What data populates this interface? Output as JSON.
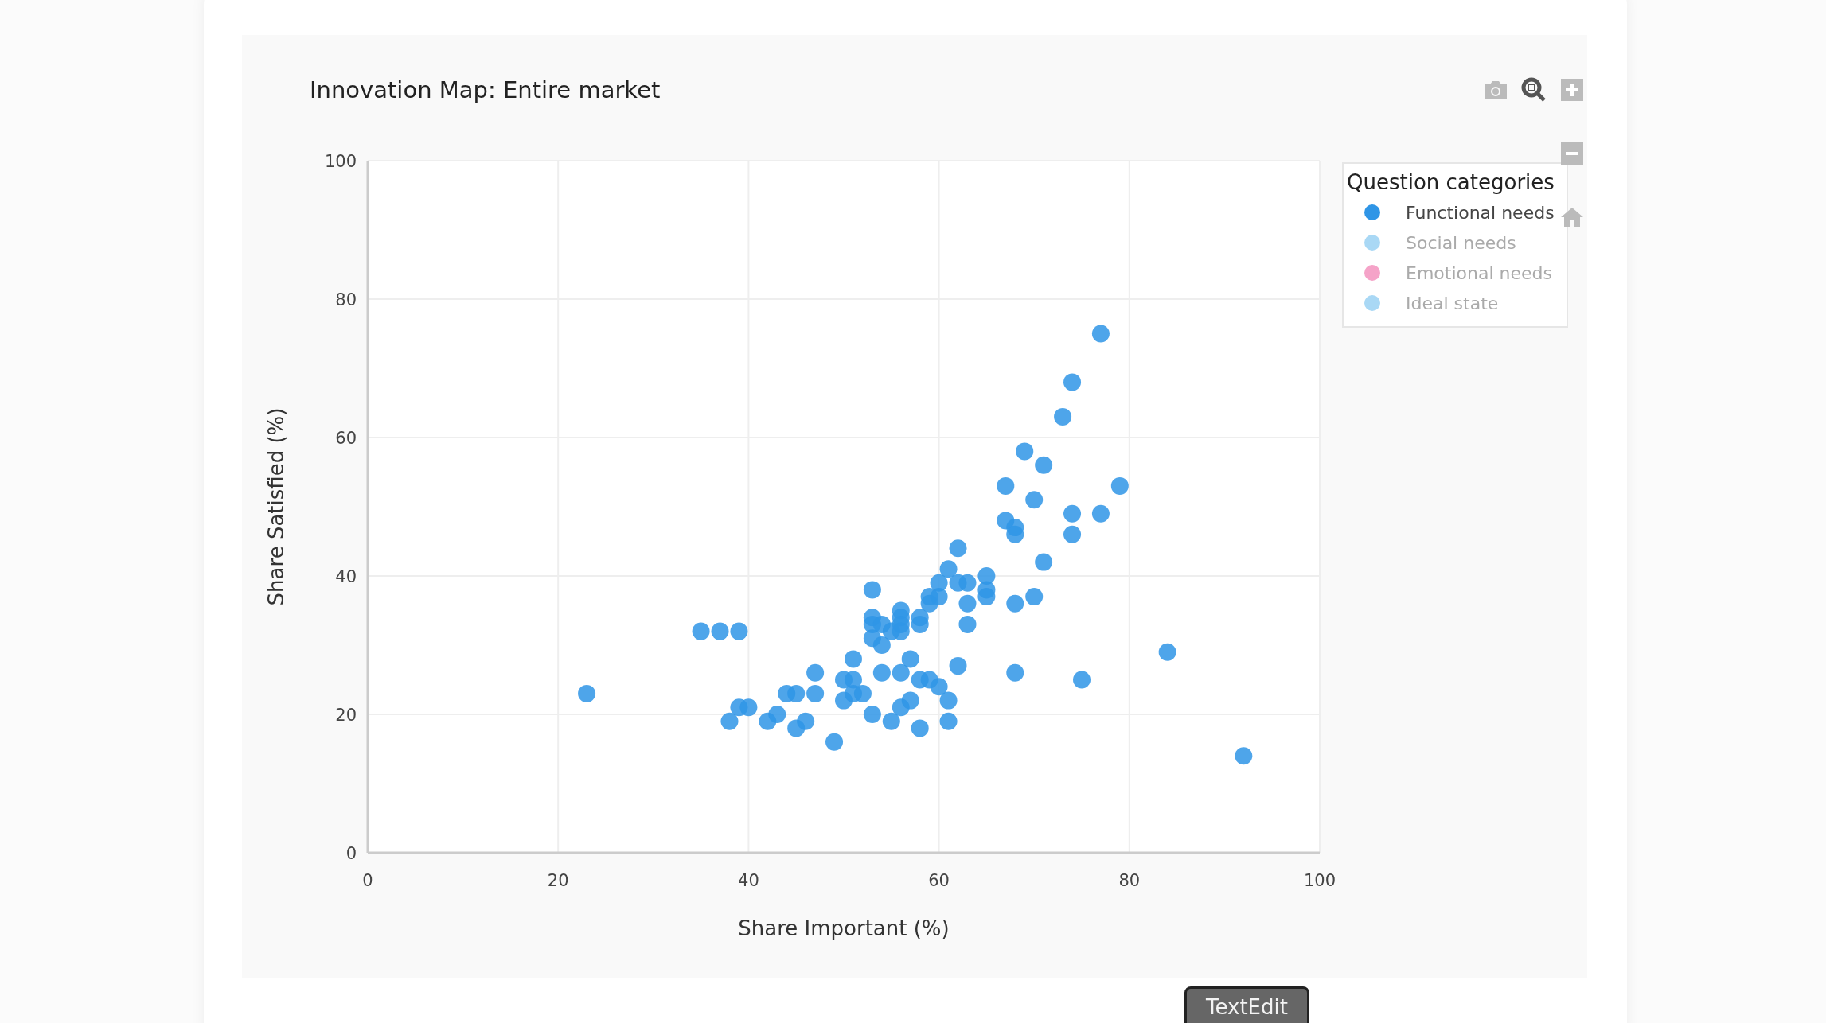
{
  "chart": {
    "title": "Innovation Map: Entire market",
    "chart_data": {
      "type": "scatter",
      "grid": true,
      "xlabel": "Share Important (%)",
      "ylabel": "Share Satisfied (%)",
      "xlim": [
        0,
        100
      ],
      "ylim": [
        0,
        100
      ],
      "xticks": [
        0,
        20,
        40,
        60,
        80,
        100
      ],
      "yticks": [
        0,
        20,
        40,
        60,
        80,
        100
      ],
      "series": [
        {
          "color": "#2f95e6",
          "x": [
            23,
            35,
            37,
            39,
            38,
            39,
            40,
            42,
            43,
            44,
            45,
            45,
            46,
            47,
            47,
            49,
            50,
            50,
            51,
            51,
            51,
            52,
            53,
            53,
            53,
            53,
            53,
            54,
            54,
            54,
            55,
            55,
            56,
            56,
            56,
            56,
            56,
            56,
            57,
            57,
            58,
            58,
            58,
            58,
            59,
            59,
            59,
            60,
            60,
            60,
            61,
            61,
            61,
            62,
            62,
            62,
            63,
            63,
            63,
            65,
            65,
            65,
            67,
            67,
            68,
            68,
            68,
            68,
            69,
            70,
            70,
            71,
            71,
            73,
            74,
            74,
            74,
            75,
            77,
            77,
            79,
            84,
            92
          ],
          "values": [
            23,
            32,
            32,
            32,
            19,
            21,
            21,
            19,
            20,
            23,
            23,
            18,
            19,
            26,
            23,
            16,
            25,
            22,
            28,
            25,
            23,
            23,
            38,
            34,
            33,
            31,
            20,
            33,
            30,
            26,
            32,
            19,
            35,
            34,
            33,
            32,
            26,
            21,
            28,
            22,
            34,
            33,
            25,
            18,
            37,
            36,
            25,
            39,
            37,
            24,
            41,
            22,
            19,
            44,
            39,
            27,
            39,
            36,
            33,
            40,
            38,
            37,
            53,
            48,
            47,
            46,
            36,
            26,
            58,
            51,
            37,
            56,
            42,
            63,
            68,
            49,
            46,
            25,
            75,
            49,
            53,
            29,
            14
          ]
        }
      ]
    }
  },
  "legend": {
    "title": "Question categories",
    "items": [
      {
        "label": "Functional needs",
        "color": "#2f95e6",
        "visible": true
      },
      {
        "label": "Social needs",
        "color": "#a9d8f5",
        "visible": false
      },
      {
        "label": "Emotional needs",
        "color": "#f5a3c8",
        "visible": false
      },
      {
        "label": "Ideal state",
        "color": "#a9d8f5",
        "visible": false
      }
    ]
  },
  "modebar": [
    {
      "kind": "camera",
      "active": false
    },
    {
      "kind": "zoom",
      "active": true
    },
    {
      "kind": "plus",
      "active": false
    },
    {
      "kind": "minus",
      "active": false
    },
    {
      "kind": "home",
      "active": false
    }
  ],
  "tooltip": "TextEdit"
}
